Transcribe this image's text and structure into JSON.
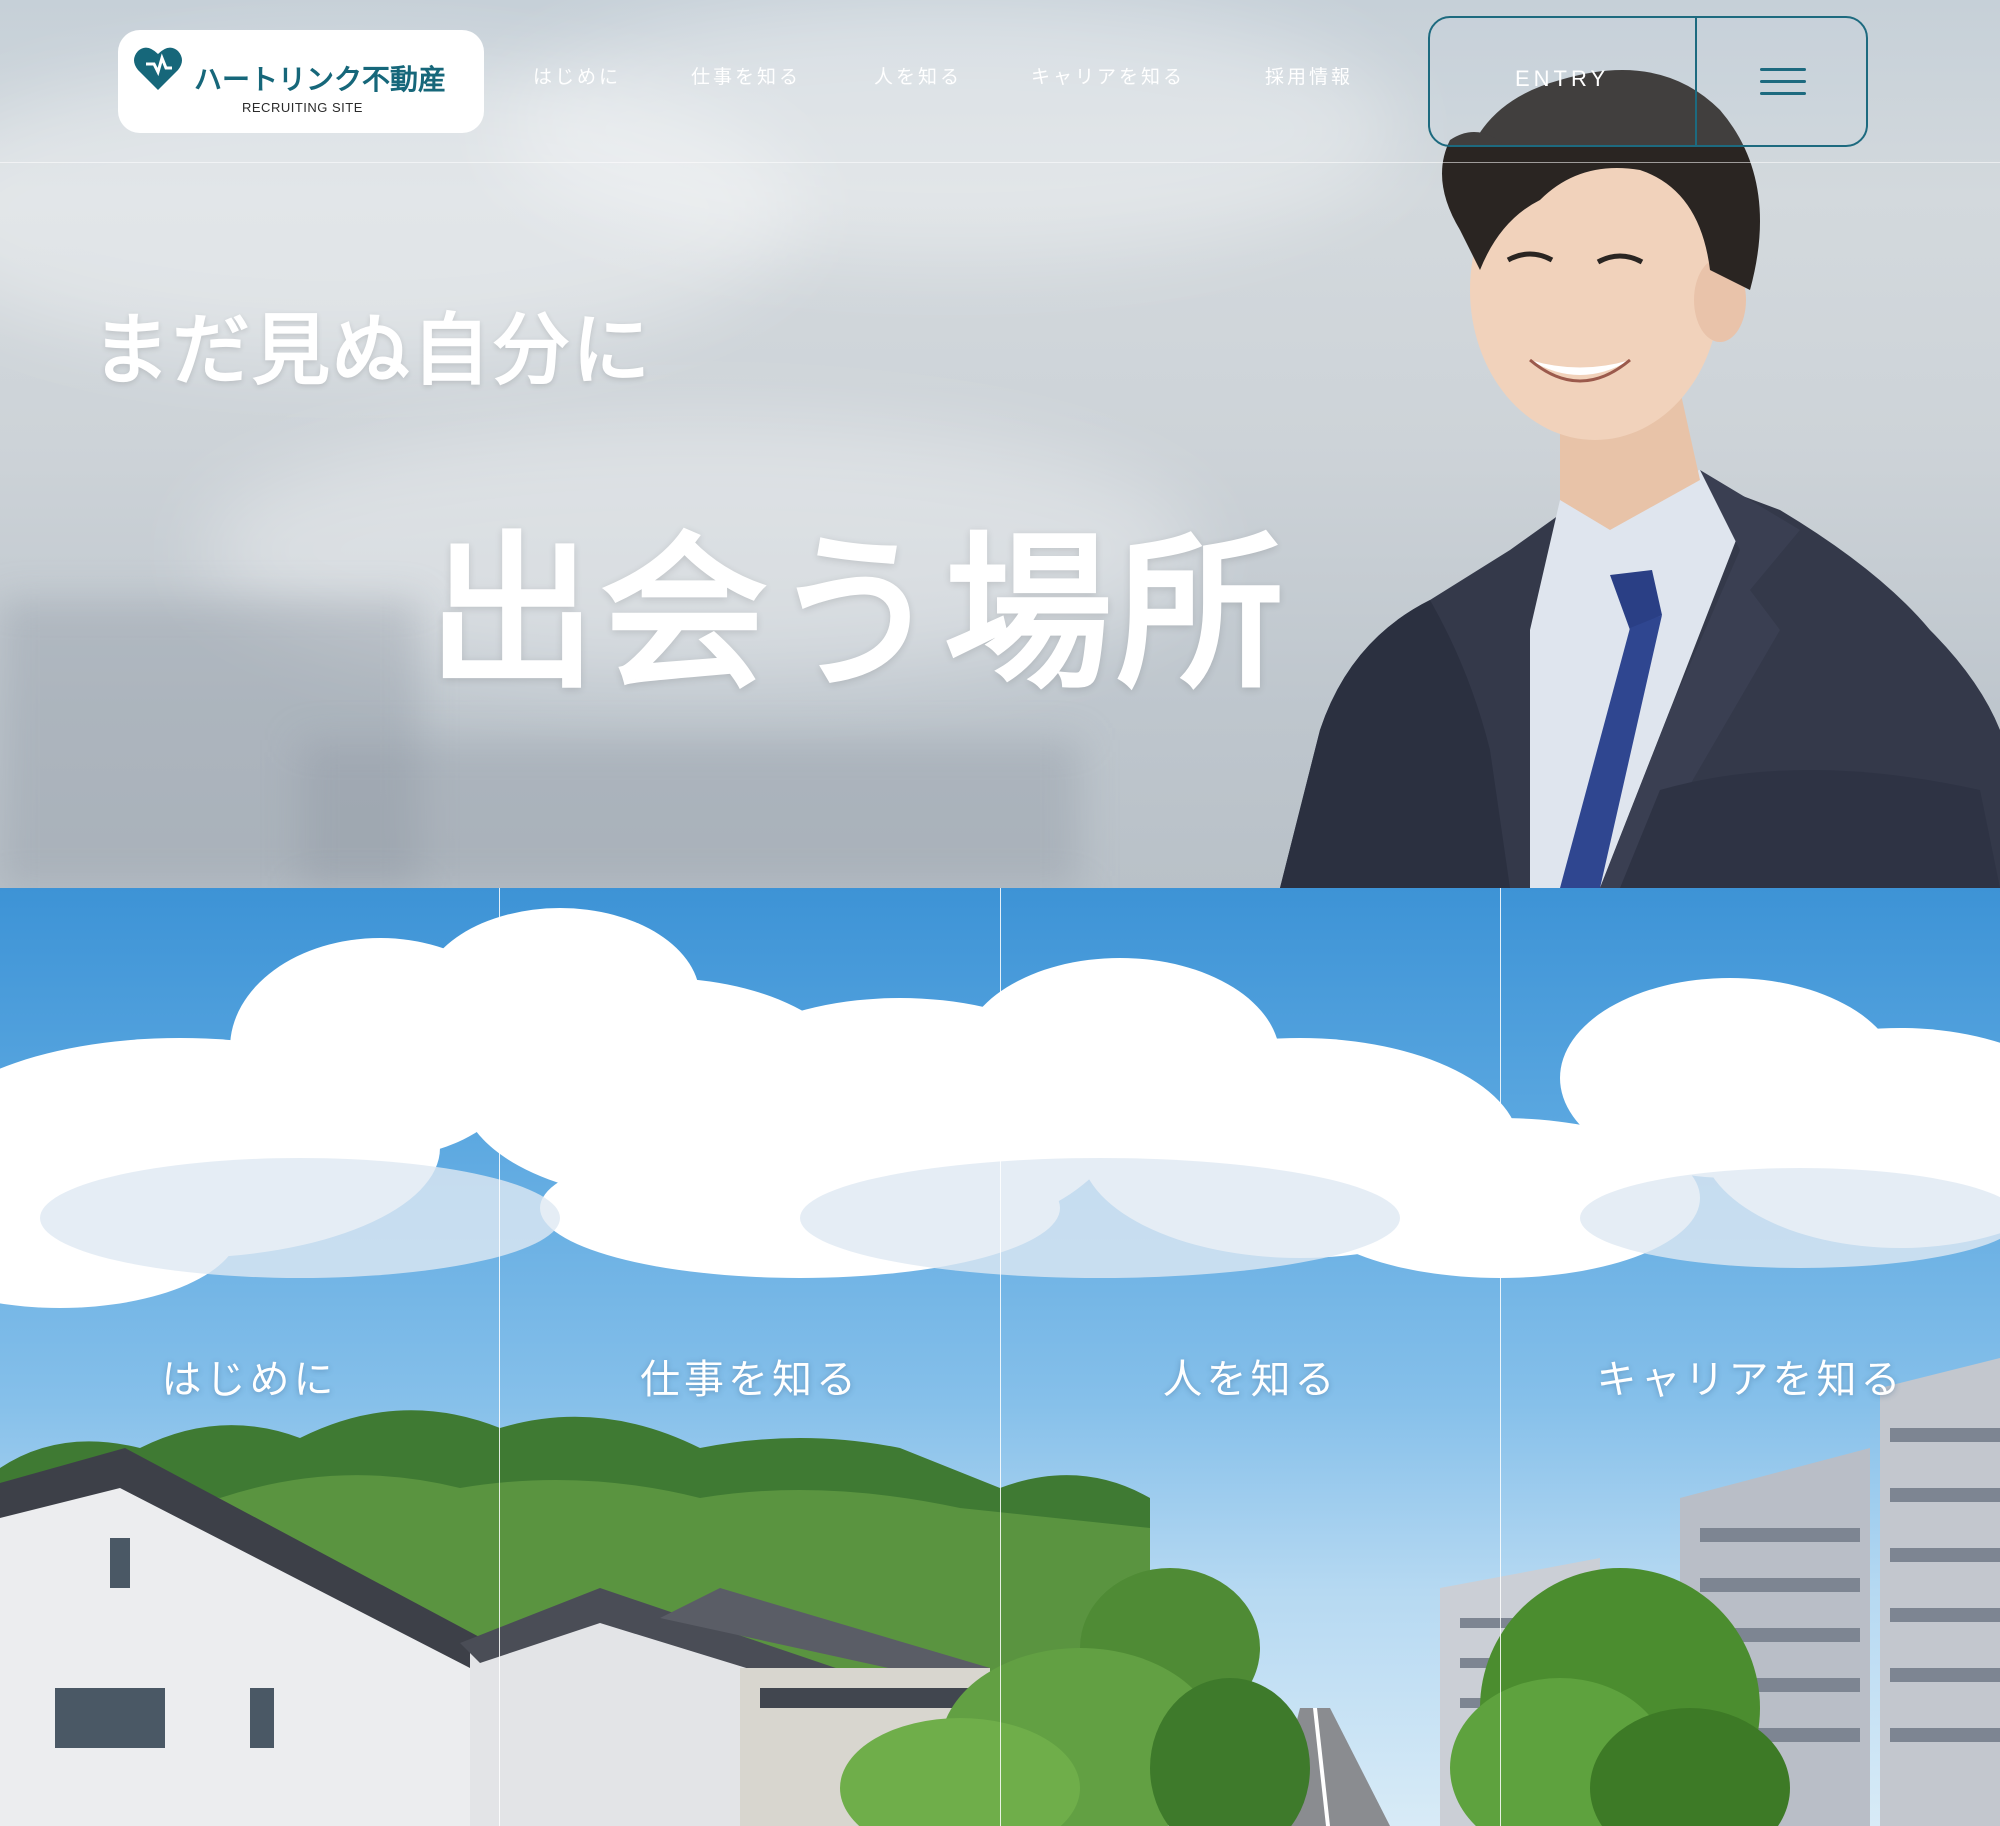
{
  "header": {
    "logo": {
      "name": "ハートリンク不動産",
      "sub": "RECRUITING SITE",
      "icon": "heart-icon"
    },
    "nav": [
      {
        "label": "はじめに"
      },
      {
        "label": "仕事を知る"
      },
      {
        "label": "人を知る"
      },
      {
        "label": "キャリアを知る"
      },
      {
        "label": "採用情報"
      }
    ],
    "entry_label": "ENTRY",
    "menu_icon": "hamburger-icon"
  },
  "hero": {
    "catch_line1": "まだ見ぬ自分に",
    "catch_line2": "出会う場所"
  },
  "panels": [
    {
      "label": "はじめに"
    },
    {
      "label": "仕事を知る"
    },
    {
      "label": "人を知る"
    },
    {
      "label": "キャリアを知る"
    }
  ],
  "colors": {
    "brand": "#16677a",
    "accent_border": "#1d6a7f",
    "sky": "#4c9fdc"
  }
}
